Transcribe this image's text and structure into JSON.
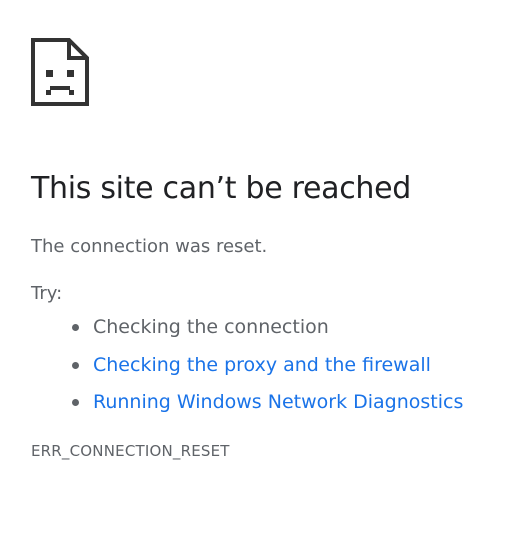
{
  "icon": "sad-page-icon",
  "colors": {
    "heading": "#202124",
    "text": "#5f6368",
    "link": "#1a73e8",
    "icon": "#333333"
  },
  "main": {
    "headline": "This site can’t be reached",
    "subtext": "The connection was reset.",
    "try_label": "Try:",
    "suggestions": [
      {
        "text": "Checking the connection",
        "is_link": false
      },
      {
        "text": "Checking the proxy and the firewall",
        "is_link": true
      },
      {
        "text": "Running Windows Network Diagnostics",
        "is_link": true
      }
    ],
    "error_code": "ERR_CONNECTION_RESET"
  }
}
